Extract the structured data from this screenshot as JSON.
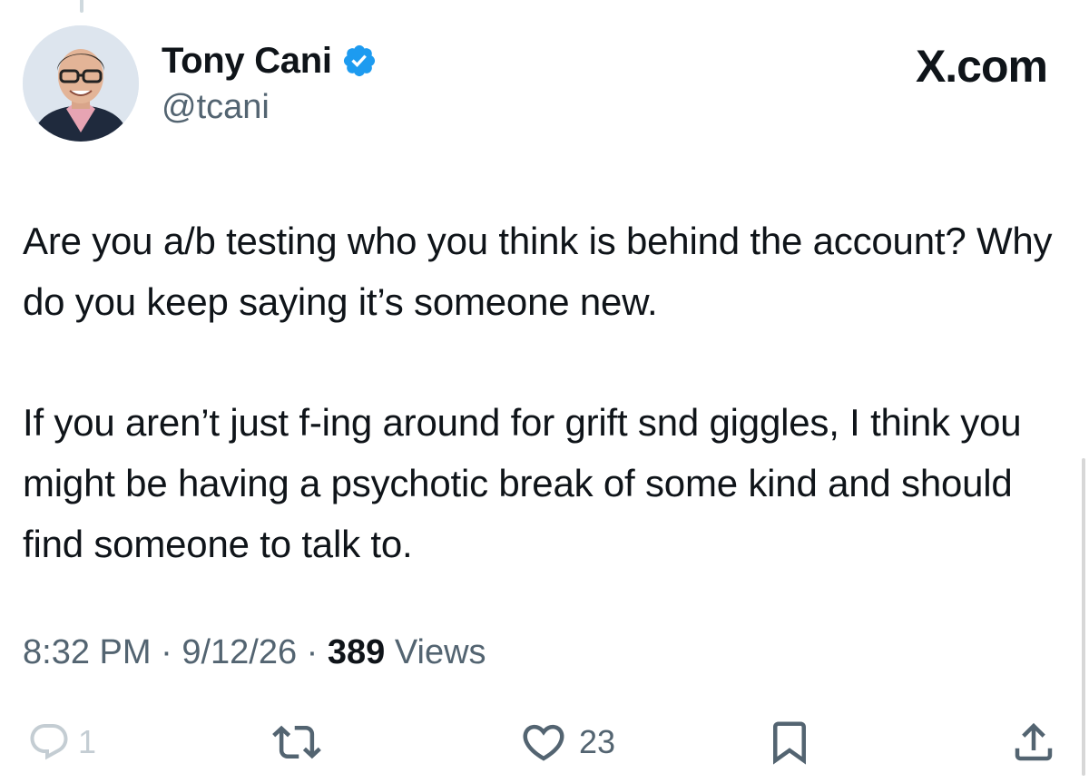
{
  "header": {
    "display_name": "Tony Cani",
    "handle": "@tcani",
    "brand": "X.com"
  },
  "tweet": {
    "paragraphs": [
      "Are you a/b testing who you think is behind the account? Why do you keep saying it’s someone new.",
      "If you aren’t just f-ing around for grift snd giggles, I think you might be having a psychotic break of some kind and should find someone to talk to."
    ],
    "time": "8:32 PM",
    "date": "9/12/26",
    "views_count": "389",
    "views_label": "Views"
  },
  "actions": {
    "reply_count": "1",
    "like_count": "23"
  },
  "icons": {
    "verified": "verified-badge-icon",
    "reply": "reply-icon",
    "repost": "repost-icon",
    "like": "heart-icon",
    "bookmark": "bookmark-icon",
    "share": "share-icon"
  },
  "colors": {
    "text": "#0f1419",
    "secondary": "#536471",
    "verified": "#1d9bf0",
    "faded": "#c4cdd3"
  }
}
